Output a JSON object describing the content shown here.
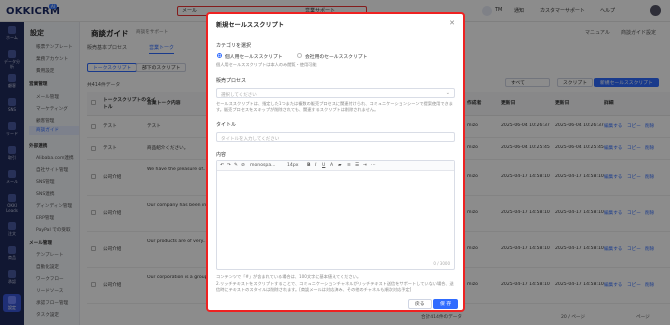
{
  "app": {
    "logo": "OKKICRM",
    "badge": "AI"
  },
  "topbar": {
    "nav_mail": "メール",
    "nav_sales": "営業サポート",
    "user_initials": "TM",
    "notice": "通知",
    "support": "カスタマーサポート",
    "help": "ヘルプ"
  },
  "left_sidebar": [
    {
      "label": "ホーム",
      "icon": "home-icon"
    },
    {
      "label": "データ分析",
      "icon": "chart-icon"
    },
    {
      "label": "顧客",
      "icon": "user-icon"
    },
    {
      "label": "SNS",
      "icon": "chat-icon"
    },
    {
      "label": "リード",
      "icon": "lead-icon"
    },
    {
      "label": "取引",
      "icon": "deal-icon"
    },
    {
      "label": "メール",
      "icon": "mail-icon"
    },
    {
      "label": "OKKI Leads",
      "icon": "leads-icon"
    },
    {
      "label": "注文",
      "icon": "order-icon"
    },
    {
      "label": "商品",
      "icon": "box-icon"
    },
    {
      "label": "承認",
      "icon": "check-icon"
    },
    {
      "label": "設定",
      "icon": "gear-icon"
    }
  ],
  "sub_sidebar": {
    "title": "設定",
    "items": [
      {
        "label": "帳票テンプレート",
        "type": "item"
      },
      {
        "label": "業務アカウント",
        "type": "item"
      },
      {
        "label": "費用設定",
        "type": "item"
      },
      {
        "label": "営業管理",
        "type": "group"
      },
      {
        "label": "メール管理",
        "type": "item"
      },
      {
        "label": "マーケティング",
        "type": "item"
      },
      {
        "label": "顧客管理",
        "type": "item"
      },
      {
        "label": "商談ガイド",
        "type": "active"
      },
      {
        "label": "外部連携",
        "type": "group"
      },
      {
        "label": "Alibaba.com連携",
        "type": "item"
      },
      {
        "label": "自社サイト管理",
        "type": "item"
      },
      {
        "label": "SNS管理",
        "type": "item"
      },
      {
        "label": "SNS連携",
        "type": "item"
      },
      {
        "label": "ディンディン管理",
        "type": "item"
      },
      {
        "label": "ERP管理",
        "type": "item"
      },
      {
        "label": "PayPal での受取",
        "type": "item"
      },
      {
        "label": "メール管理",
        "type": "group"
      },
      {
        "label": "テンプレート",
        "type": "item"
      },
      {
        "label": "自動化設定",
        "type": "item"
      },
      {
        "label": "ワークフロー",
        "type": "item"
      },
      {
        "label": "リードソース",
        "type": "item"
      },
      {
        "label": "承認フロー管理",
        "type": "item"
      },
      {
        "label": "タスク設定",
        "type": "item"
      }
    ]
  },
  "page": {
    "title": "商談ガイド",
    "subtitle": "商談をサポート",
    "manual": "マニュアル",
    "guide_settings": "商談ガイド設定",
    "tab_basic": "販売基本プロセス",
    "tab_talk": "営業トーク",
    "btn_talk_script": "トークスクリプト",
    "btn_sub_script": "部下のスクリプト",
    "count": "共414件データ",
    "filter_all": "すべて",
    "btn_script": "スクリプト",
    "btn_new_script": "新規セールススクリプト",
    "footer": "合計414件のデータ",
    "page_size": "20 / ページ",
    "goto": "ページ"
  },
  "table": {
    "headers": [
      "トークスクリプトのタイトル",
      "営業トーク内容",
      "作成者",
      "更新日",
      "更新日",
      "詳細"
    ],
    "rows": [
      {
        "title": "テスト",
        "content": "テスト",
        "owner": "mizo",
        "created": "2025-06-04 10:26:37",
        "updated": "2025-06-04 10:26:37"
      },
      {
        "title": "テスト",
        "content": "商品紹介ください。",
        "owner": "mizo",
        "created": "2025-06-04 10:25:45",
        "updated": "2025-06-04 10:25:45"
      },
      {
        "title": "公司介绍",
        "content": "We have the pleasure of...",
        "owner": "mizo",
        "created": "2025-04-17 14:58:10",
        "updated": "2025-04-17 14:58:10"
      },
      {
        "title": "公司介绍",
        "content": "Our company has been in...",
        "owner": "mizo",
        "created": "2025-04-17 14:58:10",
        "updated": "2025-04-17 14:58:10"
      },
      {
        "title": "公司介绍",
        "content": "Our products are of very...",
        "owner": "mizo",
        "created": "2025-04-17 14:58:10",
        "updated": "2025-04-17 14:58:10"
      },
      {
        "title": "公司介绍",
        "content": "Our corporation is a group...",
        "owner": "mizo",
        "created": "2025-04-17 14:58:10",
        "updated": "2025-04-17 14:58:10"
      }
    ],
    "action_edit": "編集する",
    "action_copy": "コピー",
    "action_delete": "削除"
  },
  "modal": {
    "title": "新規セールススクリプト",
    "category_label": "カテゴリを選択",
    "option_personal": "個人用セールススクリプト",
    "option_company": "会社用のセールススクリプト",
    "option_hint": "個人用セールススクリプトは本人のみ閲覧・使用可能",
    "process_label": "販売プロセス",
    "process_placeholder": "選択してください",
    "process_hint": "セールススクリプトは、指定した1つまたは複数の販売プロセスに関連付けられ、コミュニケーションシーンで提案使用できます。販売プロセスをスキップが削除されても、関連するスクリプトは削除されません。",
    "title_label": "タイトル",
    "title_placeholder": "タイトルを入力してください",
    "content_label": "内容",
    "toolbar_font": "monospa...",
    "toolbar_size": "14px",
    "char_count": "0 / 3000",
    "content_hint1": "コンテンツで「#」が含まれている場合は、100文字に基本値えてください。",
    "content_hint2": "2.リッチテキストをスクリプトすることで、コミュニケーションチャネルがリッチテキスト送信をサポートしていない場合、送信時にテキストのスタイルは削除されます。[商談メールは対応済み、その他のチャネルも順次対応予定]",
    "btn_back": "戻る",
    "btn_save": "保 存"
  }
}
